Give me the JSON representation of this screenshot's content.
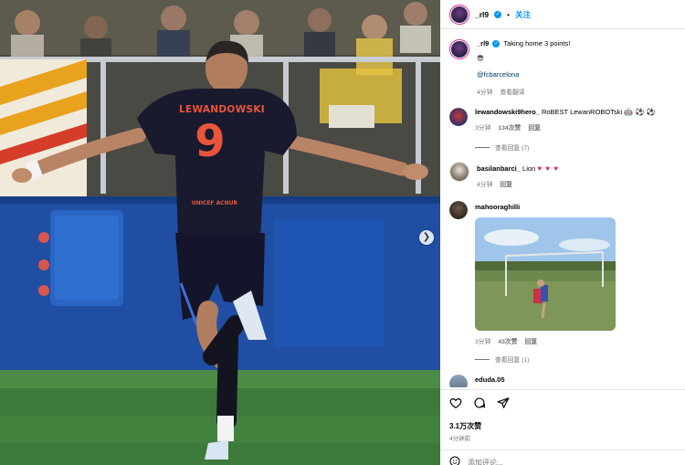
{
  "photo": {
    "jersey_name": "LEWANDOWSKI",
    "jersey_number": "9",
    "sponsor": "UNICEF ACNUR",
    "next_icon": "chevron-right-icon"
  },
  "header": {
    "username": "_rl9",
    "separator": "•",
    "follow_label": "关注"
  },
  "caption": {
    "username": "_rl9",
    "text": "Taking home 3 points!",
    "emoji": "😎",
    "mention": "@fcbarcelona",
    "time": "4分钟",
    "translate_label": "查看翻译"
  },
  "comments": [
    {
      "username": "lewandowski9hero_",
      "text": "RoBEST LewanROBOTski",
      "emoji": "🤖 ⚽ ⚽",
      "time": "3分钟",
      "likes": "134次赞",
      "reply": "回复",
      "replies_label": "查看回复 (7)"
    },
    {
      "username": "basilanbarci_",
      "text": "Lion",
      "emoji": "♥ ♥ ♥",
      "time": "4分钟",
      "reply": "回复"
    },
    {
      "username": "mahooraghilli",
      "time": "3分钟",
      "likes": "43次赞",
      "reply": "回复",
      "replies_label": "查看回复 (1)"
    },
    {
      "username": "eduda.05"
    }
  ],
  "footer": {
    "likes": "3.1万次赞",
    "time": "4分钟前",
    "add_comment_placeholder": "添加评论...",
    "icons": [
      "heart-icon",
      "comment-icon",
      "share-icon"
    ]
  },
  "colors": {
    "accent": "#0095f6",
    "heart": "#e0245e",
    "jersey": "#1a1a2e",
    "jersey_number": "#e8553b"
  }
}
